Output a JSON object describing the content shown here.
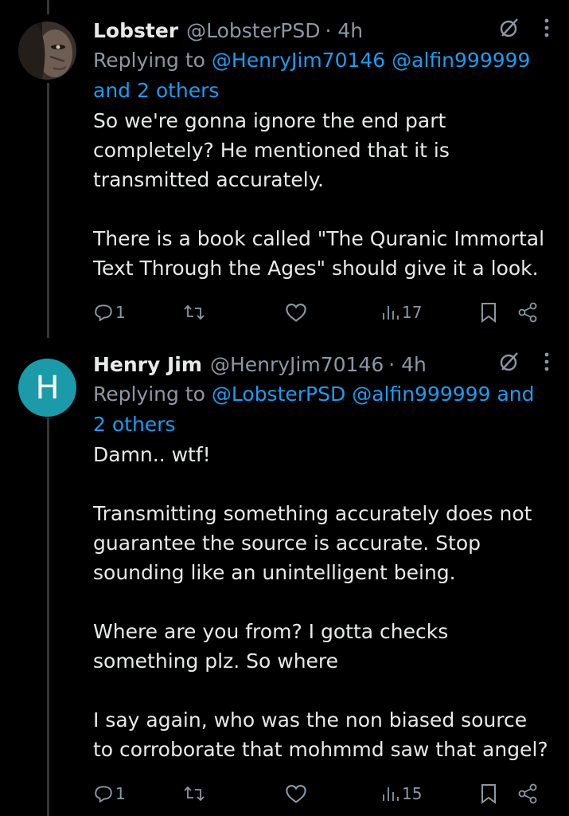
{
  "tweets": [
    {
      "name": "Lobster",
      "handle": "@LobsterPSD",
      "time": "· 4h",
      "replying_prefix": "Replying to",
      "mention_1": "@HenryJim70146",
      "mention_2": "@alfin999999",
      "mention_3": "and 2 others",
      "text": "So we're gonna ignore the end part\ncompletely? He mentioned that it is\ntransmitted accurately.\n\nThere is a book called \"The Quranic Immortal\nText Through the Ages\" should give it a look.",
      "reply_count": "1",
      "views": "17"
    },
    {
      "avatar_letter": "H",
      "name": "Henry Jim",
      "handle": "@HenryJim70146",
      "time": "· 4h",
      "replying_prefix": "Replying to",
      "mention_1": "@LobsterPSD",
      "mention_2": "@alfin999999 and",
      "mention_3": "2 others",
      "text": "Damn.. wtf!\n\nTransmitting something accurately does not\nguarantee the source is accurate. Stop\nsounding like an unintelligent being.\n\nWhere are you from? I gotta checks\nsomething plz. So where\n\nI say again, who was the non biased source\nto corroborate that mohmmd saw that angel?",
      "reply_count": "1",
      "views": "15"
    }
  ],
  "colors": {
    "background": "#000000",
    "text": "#e7e9ea",
    "muted": "#8b98a5",
    "link": "#1d9bf0",
    "avatar_h": "#1b9aaa"
  },
  "icons": [
    "grok-icon",
    "more-icon",
    "reply-icon",
    "retweet-icon",
    "like-icon",
    "views-icon",
    "bookmark-icon",
    "share-icon"
  ]
}
